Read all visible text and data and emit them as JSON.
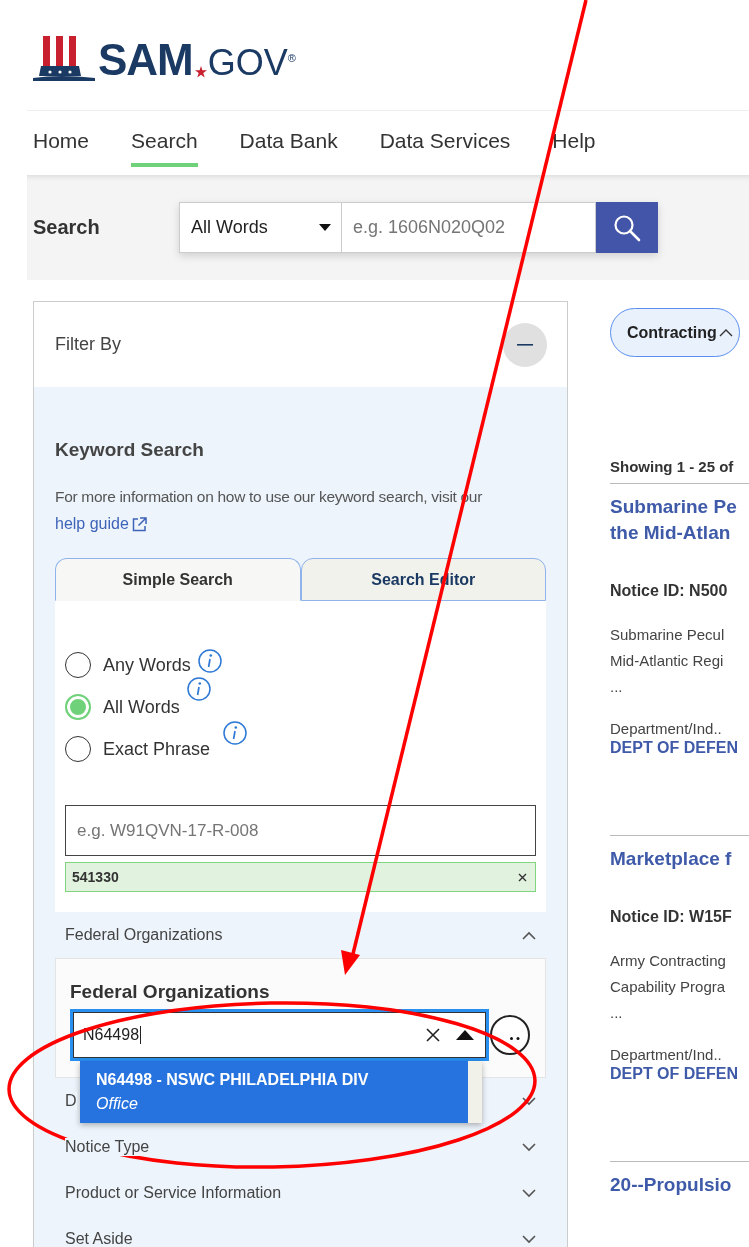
{
  "logo": {
    "name": "SAM",
    "suffix": "GOV",
    "mark": "®"
  },
  "nav": [
    {
      "label": "Home",
      "selected": false
    },
    {
      "label": "Search",
      "selected": true
    },
    {
      "label": "Data Bank",
      "selected": false
    },
    {
      "label": "Data Services",
      "selected": false
    },
    {
      "label": "Help",
      "selected": false
    }
  ],
  "search": {
    "label": "Search",
    "mode": "All Words",
    "placeholder": "e.g. 1606N020Q02"
  },
  "filter": {
    "title": "Filter By",
    "keyword": {
      "title": "Keyword Search",
      "description": "For more information on how to use our keyword search, visit our",
      "link": "help guide",
      "tabs": [
        {
          "label": "Simple Search",
          "selected": true
        },
        {
          "label": "Search Editor",
          "selected": false
        }
      ],
      "radios": [
        {
          "label": "Any Words",
          "selected": false
        },
        {
          "label": "All Words",
          "selected": true
        },
        {
          "label": "Exact Phrase",
          "selected": false
        }
      ],
      "placeholder": "e.g. W91QVN-17-R-008",
      "chips": [
        "541330"
      ]
    },
    "sections": [
      {
        "label": "Federal Organizations",
        "expanded": true,
        "panel": {
          "title": "Federal Organizations",
          "value": "N64498",
          "options": [
            {
              "name": "N64498 - NSWC PHILADELPHIA DIV",
              "type": "Office"
            }
          ]
        }
      },
      {
        "label": "D",
        "expanded": false
      },
      {
        "label": "Notice Type",
        "expanded": false
      },
      {
        "label": "Product or Service Information",
        "expanded": false
      },
      {
        "label": "Set Aside",
        "expanded": false
      }
    ]
  },
  "results": {
    "domain": "Contracting",
    "showing": "Showing 1 - 25 of",
    "items": [
      {
        "title": [
          "Submarine Pe",
          "the Mid-Atlan"
        ],
        "notice_id": "Notice ID: N500",
        "description": [
          "Submarine Pecul",
          "Mid-Atlantic Regi",
          "..."
        ],
        "department_label": "Department/Ind..",
        "department": "DEPT OF DEFEN"
      },
      {
        "title": [
          "Marketplace f"
        ],
        "notice_id": "Notice ID: W15F",
        "description": [
          "Army Contracting",
          "Capability Progra",
          "..."
        ],
        "department_label": "Department/Ind..",
        "department": "DEPT OF DEFEN"
      },
      {
        "title": [
          "20--Propulsio"
        ]
      }
    ]
  },
  "annotations": {
    "arrow": true,
    "ellipse": true
  }
}
